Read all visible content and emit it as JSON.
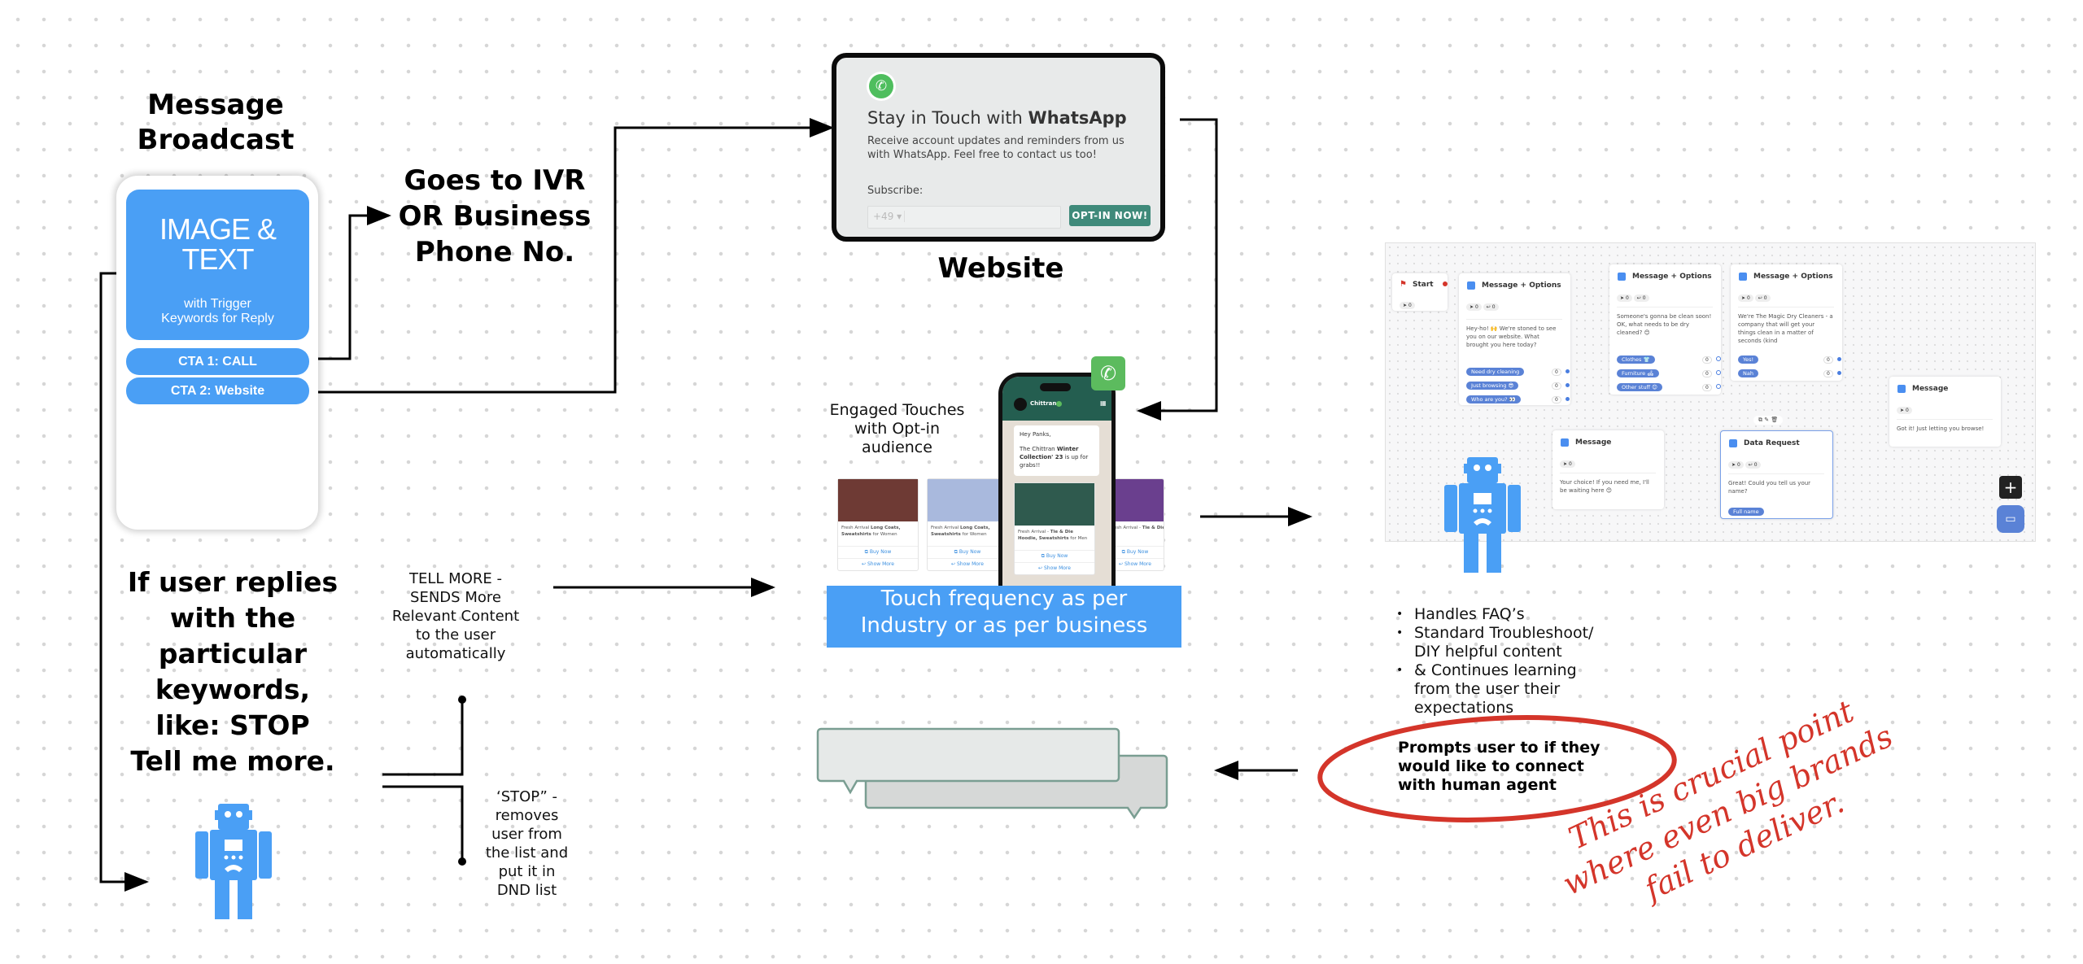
{
  "broadcast": {
    "title": "Message\nBroadcast",
    "image_block_title": "IMAGE &\nTEXT",
    "image_block_subtitle": "with Trigger\nKeywords for Reply",
    "cta1": "CTA 1: CALL",
    "cta2": "CTA 2: Website"
  },
  "ivr_label": "Goes to IVR\nOR Business\nPhone No.",
  "website": {
    "label": "Website",
    "form": {
      "title_regular": "Stay in Touch with ",
      "title_bold": "WhatsApp",
      "description": "Receive account updates and reminders from us with WhatsApp. Feel free to contact us too!",
      "subscribe_label": "Subscribe:",
      "country_code": "+49",
      "phone_value": "",
      "button": "OPT-IN NOW!"
    }
  },
  "engaged_label": "Engaged Touches\nwith Opt-in\naudience",
  "phone_mock": {
    "brand": "Chittran",
    "greeting": "Hey Panks,",
    "message_pre": "The Chittran ",
    "message_bold": "Winter Collection' 23",
    "message_post": " is up for grabs!!",
    "products": [
      {
        "text_pre": "Fresh Arrival ",
        "text_bold": "Long Coats, Sweatshirts",
        "text_post": " for Women",
        "color": "#6e3a34"
      },
      {
        "text_pre": "Fresh Arrival ",
        "text_bold": "Long Coats, Sweatshirts",
        "text_post": " for Women",
        "color": "#a9b9dd"
      },
      {
        "text_pre": "Fresh Arrival - ",
        "text_bold": "Tie & Die Hoodie, Sweatshirts",
        "text_post": " for Men",
        "color": "#2f5a4e"
      },
      {
        "text_pre": "Fresh Arrival - ",
        "text_bold": "Tie & Die Hoodie, Sweatshirts",
        "text_post": " for Men",
        "color": "#6a3f8e"
      }
    ],
    "buy_now": "Buy Now",
    "show_more": "Show More"
  },
  "touch_banner": "Touch frequency as per\nIndustry or as per business",
  "keywords_label": "If user replies\nwith the\nparticular\nkeywords,\nlike: STOP\nTell me more.",
  "tell_more_label": "TELL MORE -\nSENDS More\nRelevant Content\nto the user\nautomatically",
  "stop_label": "‘STOP” -\nremoves\nuser from\nthe list and\nput it in\nDND list",
  "flow_builder": {
    "start": {
      "title": "Start",
      "sent": "0"
    },
    "node1": {
      "title": "Message + Options",
      "sent": "0",
      "replies": "0",
      "text": "Hey-ho! 🙌 We're stoned to see you on our website. What brought you here today?",
      "options": [
        {
          "label": "Need dry cleaning",
          "count": "0"
        },
        {
          "label": "Just browsing 😎",
          "count": "0"
        },
        {
          "label": "Who are you? 👀",
          "count": "0"
        }
      ]
    },
    "node2": {
      "title": "Message + Options",
      "sent": "0",
      "replies": "0",
      "text": "Someone's gonna be clean soon! OK, what needs to be dry cleaned? 😊",
      "options": [
        {
          "label": "Clothes 👕",
          "count": "0"
        },
        {
          "label": "Furniture 🛋",
          "count": "0"
        },
        {
          "label": "Other stuff 😊",
          "count": "0"
        }
      ]
    },
    "node3": {
      "title": "Message + Options",
      "sent": "0",
      "replies": "0",
      "text": "We're The Magic Dry Cleaners - a company that will get your things clean in a matter of seconds (kind",
      "options": [
        {
          "label": "Yes!",
          "count": "0"
        },
        {
          "label": "Nah",
          "count": "0"
        }
      ]
    },
    "node4": {
      "title": "Message",
      "sent": "0",
      "text": "Your choice! If you need me, I'll be waiting here 😊"
    },
    "node5": {
      "title": "Data Request",
      "sent": "0",
      "replies": "0",
      "text": "Great! Could you tell us your name?",
      "field": "Full name"
    },
    "node6": {
      "title": "Message",
      "sent": "0",
      "text": "Got it! Just letting you browse!"
    }
  },
  "bot_features": [
    "Handles FAQ’s",
    "Standard Troubleshoot/ DIY helpful content",
    "& Continues learning from the user their expectations"
  ],
  "prompt_label": "Prompts user to if they\nwould like to connect\nwith human agent",
  "annotation": "This is crucial point\nwhere even big brands\nfail to deliver.",
  "colors": {
    "accent_blue": "#4a9ff5",
    "whatsapp_green": "#4fbe5e",
    "annotation_red": "#d4352a",
    "optin_teal": "#3f8a7a"
  }
}
